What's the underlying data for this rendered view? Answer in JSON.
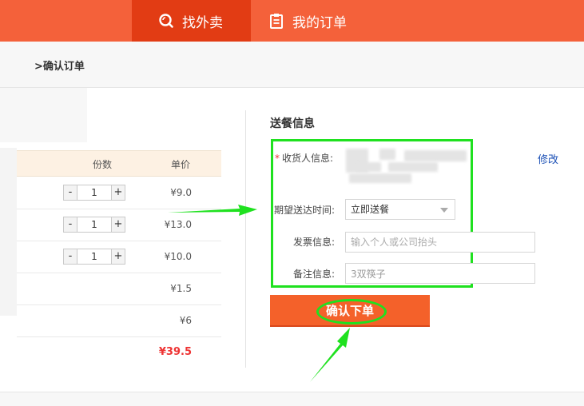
{
  "nav": {
    "tabs": [
      {
        "label": "找外卖",
        "icon": "search-icon",
        "active": true
      },
      {
        "label": "我的订单",
        "icon": "clipboard-icon",
        "active": false
      }
    ],
    "bg_color": "#f4613a",
    "active_color": "#e23c14"
  },
  "breadcrumb": ">确认订单",
  "order_table": {
    "headers": {
      "qty": "份数",
      "price": "单价"
    },
    "rows": [
      {
        "qty": "1",
        "price": "¥9.0",
        "has_stepper": true
      },
      {
        "qty": "1",
        "price": "¥13.0",
        "has_stepper": true
      },
      {
        "qty": "1",
        "price": "¥10.0",
        "has_stepper": true
      },
      {
        "price": "¥1.5",
        "has_stepper": false
      },
      {
        "price": "¥6",
        "has_stepper": false
      }
    ],
    "total": "¥39.5",
    "stepper_minus": "-",
    "stepper_plus": "+"
  },
  "delivery": {
    "title": "送餐信息",
    "required_mark": "*",
    "receiver_label": "收货人信息:",
    "edit_label": "修改",
    "time_label": "期望送达时间:",
    "time_value": "立即送餐",
    "invoice_label": "发票信息:",
    "invoice_placeholder": "输入个人或公司抬头",
    "note_label": "备注信息:",
    "note_value": "3双筷子",
    "confirm_label": "确认下单",
    "highlight_color": "#1fe11f",
    "button_color": "#f4612a"
  }
}
